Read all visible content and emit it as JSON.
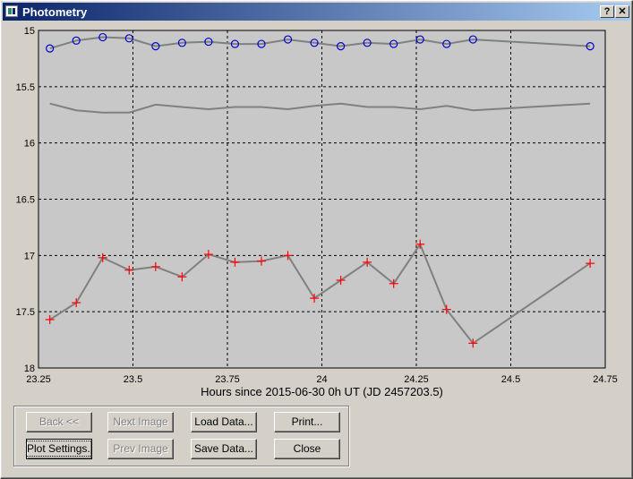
{
  "window": {
    "title": "Photometry",
    "help_label": "?",
    "close_label": "✕"
  },
  "buttons": {
    "back": "Back <<",
    "next_image": "Next Image",
    "load_data": "Load Data...",
    "print": "Print...",
    "plot_settings": "Plot Settings...",
    "prev_image": "Prev Image",
    "save_data": "Save Data...",
    "close": "Close"
  },
  "chart_data": {
    "type": "line",
    "xlabel": "Hours since 2015-06-30 0h UT (JD 2457203.5)",
    "ylabel": "",
    "xlim": [
      23.25,
      24.75
    ],
    "ylim": [
      15,
      18
    ],
    "y_inverted": true,
    "x_ticks": [
      "23.25",
      "23.5",
      "23.75",
      "24",
      "24.25",
      "24.5",
      "24.75"
    ],
    "y_ticks": [
      "15",
      "15.5",
      "16",
      "16.5",
      "17",
      "17.5",
      "18"
    ],
    "x_tick_values": [
      23.25,
      23.5,
      23.75,
      24,
      24.25,
      24.5,
      24.75
    ],
    "y_tick_values": [
      15,
      15.5,
      16,
      16.5,
      17,
      17.5,
      18
    ],
    "grid": true,
    "background_color": "#c8c8c8",
    "series": [
      {
        "marker": "circle",
        "marker_color": "#0000cc",
        "line_color": "#808080",
        "x": [
          23.28,
          23.35,
          23.42,
          23.49,
          23.56,
          23.63,
          23.7,
          23.77,
          23.84,
          23.91,
          23.98,
          24.05,
          24.12,
          24.19,
          24.26,
          24.33,
          24.4,
          24.71
        ],
        "y": [
          15.16,
          15.09,
          15.06,
          15.07,
          15.14,
          15.11,
          15.1,
          15.12,
          15.12,
          15.08,
          15.11,
          15.14,
          15.11,
          15.12,
          15.08,
          15.12,
          15.08,
          15.14
        ]
      },
      {
        "marker": "none",
        "line_color": "#808080",
        "x": [
          23.28,
          23.35,
          23.42,
          23.49,
          23.56,
          23.63,
          23.7,
          23.77,
          23.84,
          23.91,
          23.98,
          24.05,
          24.12,
          24.19,
          24.26,
          24.33,
          24.4,
          24.71
        ],
        "y": [
          15.65,
          15.71,
          15.73,
          15.73,
          15.66,
          15.68,
          15.7,
          15.68,
          15.68,
          15.7,
          15.67,
          15.65,
          15.68,
          15.68,
          15.7,
          15.67,
          15.71,
          15.65
        ]
      },
      {
        "marker": "plus",
        "marker_color": "#ff0000",
        "line_color": "#808080",
        "x": [
          23.28,
          23.35,
          23.42,
          23.49,
          23.56,
          23.63,
          23.7,
          23.77,
          23.84,
          23.91,
          23.98,
          24.05,
          24.12,
          24.19,
          24.26,
          24.33,
          24.4,
          24.71
        ],
        "y": [
          17.57,
          17.42,
          17.02,
          17.13,
          17.1,
          17.19,
          16.99,
          17.06,
          17.05,
          17.0,
          17.38,
          17.22,
          17.06,
          17.25,
          16.9,
          17.48,
          17.78,
          17.07
        ]
      }
    ]
  }
}
